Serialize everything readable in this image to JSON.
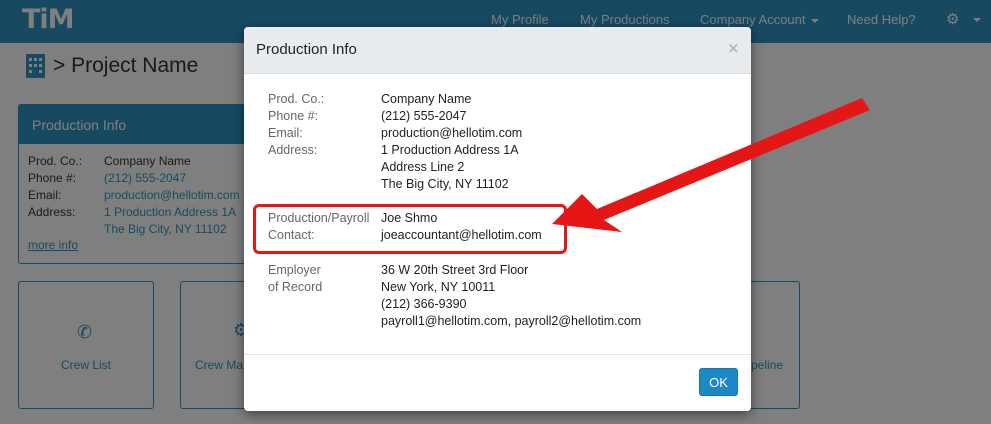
{
  "app": {
    "logo": "TiM"
  },
  "nav": {
    "my_profile": "My Profile",
    "my_productions": "My Productions",
    "company_account": "Company Account",
    "need_help": "Need Help?"
  },
  "page": {
    "title": "> Project Name"
  },
  "bg_panel": {
    "title": "Production Info",
    "prod_co_label": "Prod. Co.:",
    "prod_co_value": "Company Name",
    "phone_label": "Phone #:",
    "phone_value": "(212) 555-2047",
    "email_label": "Email:",
    "email_value": "production@hellotim.com",
    "address_label": "Address:",
    "address_line1": "1 Production Address 1A",
    "address_line2": "The Big City, NY 11102",
    "more_info": "more info"
  },
  "tiles": {
    "crew_list": "Crew List",
    "crew_ma": "Crew Ma",
    "peline": "peline"
  },
  "modal": {
    "title": "Production Info",
    "close": "×",
    "prod_co_label": "Prod. Co.:",
    "prod_co_value": "Company Name",
    "phone_label": "Phone #:",
    "phone_value": "(212) 555-2047",
    "email_label": "Email:",
    "email_value": "production@hellotim.com",
    "address_label": "Address:",
    "address_line1": "1 Production Address 1A",
    "address_line2": "Address Line 2",
    "address_line3": "The Big City, NY 11102",
    "contact_label_1": "Production/Payroll",
    "contact_label_2": "Contact:",
    "contact_name": "Joe Shmo",
    "contact_email": "joeaccountant@hellotim.com",
    "employer_label_1": "Employer",
    "employer_label_2": "of Record",
    "employer_line1": "36 W 20th Street 3rd Floor",
    "employer_line2": "New York, NY 10011",
    "employer_phone": "(212) 366-9390",
    "employer_emails": "payroll1@hellotim.com, payroll2@hellotim.com",
    "ok": "OK"
  },
  "colors": {
    "brand": "#2f94c2",
    "annotation": "#e51616",
    "button": "#1e88c7"
  },
  "icons": [
    "building-icon",
    "phone-icon",
    "gear-icon",
    "close-icon",
    "caret-down-icon"
  ]
}
